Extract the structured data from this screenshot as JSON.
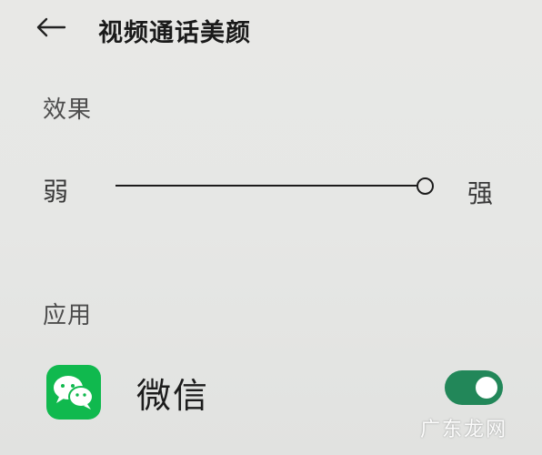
{
  "header": {
    "back_icon": "arrow-left-icon",
    "title": "视频通话美颜"
  },
  "effect": {
    "section_label": "效果",
    "slider": {
      "min_label": "弱",
      "max_label": "强",
      "value": 1.0
    }
  },
  "apps": {
    "section_label": "应用",
    "items": [
      {
        "name": "微信",
        "icon": "wechat-icon",
        "icon_color": "#10b94e",
        "enabled": true,
        "toggle_color": "#228759"
      }
    ]
  },
  "watermark": "广东龙网"
}
